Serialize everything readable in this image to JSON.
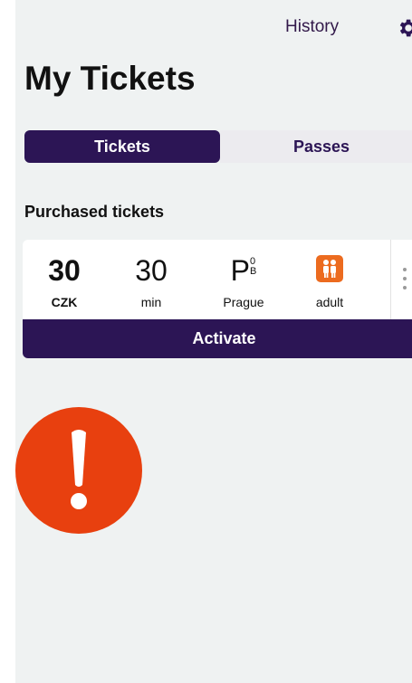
{
  "header": {
    "history_label": "History",
    "settings_icon": "gear-icon"
  },
  "page": {
    "title": "My Tickets"
  },
  "tabs": [
    {
      "label": "Tickets",
      "active": true
    },
    {
      "label": "Passes",
      "active": false
    }
  ],
  "section": {
    "title": "Purchased tickets"
  },
  "ticket": {
    "price_value": "30",
    "price_currency": "CZK",
    "duration_value": "30",
    "duration_unit": "min",
    "zone_letter": "P",
    "zone_sub_top": "0",
    "zone_sub_bottom": "B",
    "zone_city": "Prague",
    "fare_icon": "people-icon",
    "fare_label": "adult",
    "more_icon": "more-vertical-icon"
  },
  "actions": {
    "activate_label": "Activate"
  },
  "alert": {
    "icon": "exclamation-icon",
    "color": "#e8400f"
  },
  "colors": {
    "primary": "#2c1555",
    "fare_badge": "#ec6b1f",
    "background": "#eff2f2"
  }
}
